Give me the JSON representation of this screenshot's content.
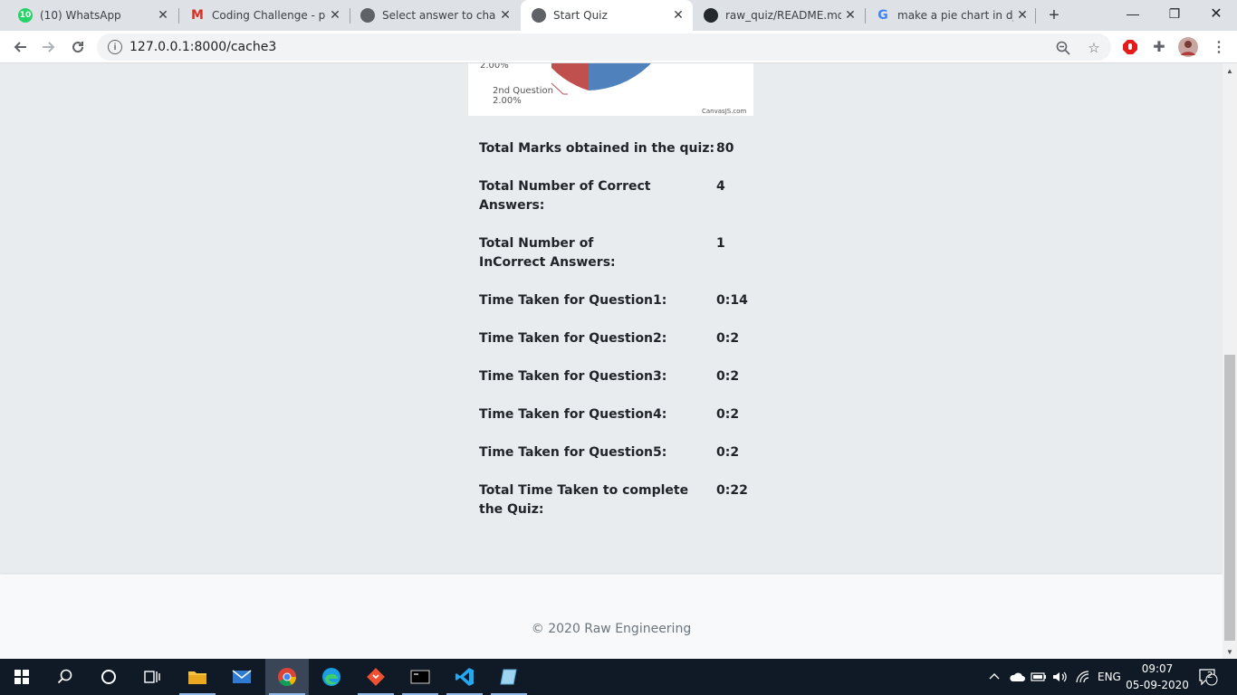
{
  "browser": {
    "tabs": [
      {
        "title": "(10) WhatsApp",
        "badge": "10"
      },
      {
        "title": "Coding Challenge - paw"
      },
      {
        "title": "Select answer to change"
      },
      {
        "title": "Start Quiz"
      },
      {
        "title": "raw_quiz/README.md at"
      },
      {
        "title": "make a pie chart in djan"
      }
    ],
    "url": "127.0.0.1:8000/cache3"
  },
  "chart": {
    "label_top_value": "2.00%",
    "label_bottom_name": "2nd Question",
    "label_bottom_value": "2.00%",
    "credit": "CanvasJS.com"
  },
  "chart_data": {
    "type": "pie",
    "categories": [
      "2nd Question"
    ],
    "values": [
      2.0
    ],
    "colors": {
      "question2": "#c0504e",
      "main": "#4f81bc"
    }
  },
  "results": {
    "rows": [
      {
        "label": "Total Marks obtained in the quiz:",
        "value": "80"
      },
      {
        "label": "Total Number of Correct Answers:",
        "value": "4"
      },
      {
        "label": "Total Number of InCorrect Answers:",
        "value": "1"
      },
      {
        "label": "Time Taken for Question1:",
        "value": "0:14"
      },
      {
        "label": "Time Taken for Question2:",
        "value": "0:2"
      },
      {
        "label": "Time Taken for Question3:",
        "value": "0:2"
      },
      {
        "label": "Time Taken for Question4:",
        "value": "0:2"
      },
      {
        "label": "Time Taken for Question5:",
        "value": "0:2"
      },
      {
        "label": "Total Time Taken to complete the Quiz:",
        "value": "0:22"
      }
    ]
  },
  "footer": {
    "copyright": "© 2020 Raw Engineering"
  },
  "taskbar": {
    "language": "ENG",
    "time": "09:07",
    "date": "05-09-2020",
    "notifications": "2"
  },
  "colors": {
    "accent": "#4f81bc",
    "page_bg": "#e9ecef",
    "taskbar_bg": "#101a26"
  }
}
